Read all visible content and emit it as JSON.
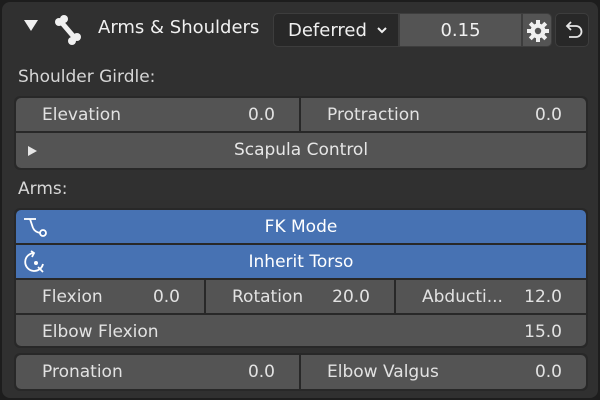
{
  "header": {
    "title": "Arms & Shoulders",
    "mode_dropdown": "Deferred",
    "value_field": "0.15",
    "icons": [
      "collapse-triangle-icon",
      "bone-icon",
      "chevron-down-icon",
      "gear-icon",
      "undo-icon"
    ]
  },
  "shoulder": {
    "section_label": "Shoulder Girdle:",
    "elevation": {
      "label": "Elevation",
      "value": "0.0"
    },
    "protraction": {
      "label": "Protraction",
      "value": "0.0"
    },
    "scapula_button": "Scapula Control"
  },
  "arms": {
    "section_label": "Arms:",
    "fk_mode": "FK Mode",
    "inherit_torso": "Inherit Torso",
    "flexion": {
      "label": "Flexion",
      "value": "0.0"
    },
    "rotation": {
      "label": "Rotation",
      "value": "20.0"
    },
    "abduction": {
      "label": "Abducti...",
      "value": "12.0"
    },
    "elbow_flexion": {
      "label": "Elbow Flexion",
      "value": "15.0"
    },
    "pronation": {
      "label": "Pronation",
      "value": "0.0"
    },
    "elbow_valgus": {
      "label": "Elbow Valgus",
      "value": "0.0"
    }
  },
  "colors": {
    "panel": "#303030",
    "field": "#545454",
    "active_blue": "#4772b3"
  }
}
